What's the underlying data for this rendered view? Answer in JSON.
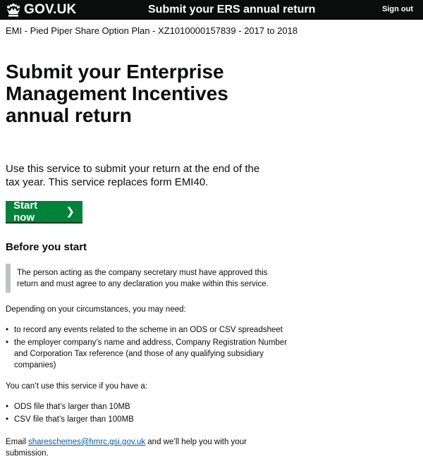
{
  "header": {
    "logo_text": "GOV.UK",
    "service_name": "Submit your ERS annual return",
    "sign_out_label": "Sign out"
  },
  "scheme_bar": "EMI - Pied Piper Share Option Plan - XZ1010000157839 - 2017 to 2018",
  "main": {
    "title": "Submit your Enterprise Management Incentives annual return",
    "lead": "Use this service to submit your return at the end of the tax year. This service replaces form EMI40.",
    "start_label": "Start now",
    "start_arrow": "❯",
    "before_heading": "Before you start",
    "inset_text": "The person acting as the company secretary must have approved this return and must agree to any declaration you make within this service.",
    "may_need": "Depending on your circumstances, you may need:",
    "needs": [
      "to record any events related to the scheme in an ODS or CSV spreadsheet",
      "the employer company’s name and address, Company Registration Number and Corporation Tax reference (and those of any qualifying subsidiary companies)"
    ],
    "cant_use": "You can’t use this service if you have a:",
    "limits": [
      "ODS file that’s larger than 10MB",
      "CSV file that’s larger than 100MB"
    ],
    "email_prefix": "Email ",
    "email_link": "shareschemes@hmrc.gsi.gov.uk",
    "email_suffix": " and we’ll help you with your submission."
  },
  "colors": {
    "header_bg": "#0b0c0c",
    "button_green": "#00823b",
    "link_blue": "#005ea5",
    "inset_border": "#bfc1c3"
  },
  "icons": {
    "logo": "crown-icon",
    "start": "chevron-right-icon"
  }
}
